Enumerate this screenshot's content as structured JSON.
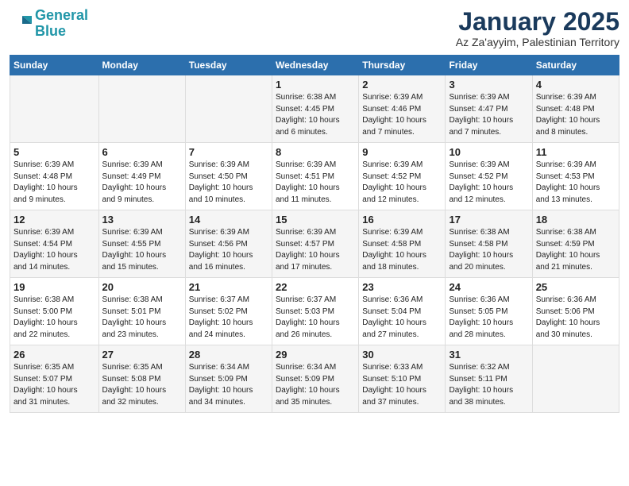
{
  "logo": {
    "line1": "General",
    "line2": "Blue"
  },
  "title": "January 2025",
  "subtitle": "Az Za'ayyim, Palestinian Territory",
  "days_of_week": [
    "Sunday",
    "Monday",
    "Tuesday",
    "Wednesday",
    "Thursday",
    "Friday",
    "Saturday"
  ],
  "weeks": [
    [
      {
        "num": "",
        "info": ""
      },
      {
        "num": "",
        "info": ""
      },
      {
        "num": "",
        "info": ""
      },
      {
        "num": "1",
        "info": "Sunrise: 6:38 AM\nSunset: 4:45 PM\nDaylight: 10 hours\nand 6 minutes."
      },
      {
        "num": "2",
        "info": "Sunrise: 6:39 AM\nSunset: 4:46 PM\nDaylight: 10 hours\nand 7 minutes."
      },
      {
        "num": "3",
        "info": "Sunrise: 6:39 AM\nSunset: 4:47 PM\nDaylight: 10 hours\nand 7 minutes."
      },
      {
        "num": "4",
        "info": "Sunrise: 6:39 AM\nSunset: 4:48 PM\nDaylight: 10 hours\nand 8 minutes."
      }
    ],
    [
      {
        "num": "5",
        "info": "Sunrise: 6:39 AM\nSunset: 4:48 PM\nDaylight: 10 hours\nand 9 minutes."
      },
      {
        "num": "6",
        "info": "Sunrise: 6:39 AM\nSunset: 4:49 PM\nDaylight: 10 hours\nand 9 minutes."
      },
      {
        "num": "7",
        "info": "Sunrise: 6:39 AM\nSunset: 4:50 PM\nDaylight: 10 hours\nand 10 minutes."
      },
      {
        "num": "8",
        "info": "Sunrise: 6:39 AM\nSunset: 4:51 PM\nDaylight: 10 hours\nand 11 minutes."
      },
      {
        "num": "9",
        "info": "Sunrise: 6:39 AM\nSunset: 4:52 PM\nDaylight: 10 hours\nand 12 minutes."
      },
      {
        "num": "10",
        "info": "Sunrise: 6:39 AM\nSunset: 4:52 PM\nDaylight: 10 hours\nand 12 minutes."
      },
      {
        "num": "11",
        "info": "Sunrise: 6:39 AM\nSunset: 4:53 PM\nDaylight: 10 hours\nand 13 minutes."
      }
    ],
    [
      {
        "num": "12",
        "info": "Sunrise: 6:39 AM\nSunset: 4:54 PM\nDaylight: 10 hours\nand 14 minutes."
      },
      {
        "num": "13",
        "info": "Sunrise: 6:39 AM\nSunset: 4:55 PM\nDaylight: 10 hours\nand 15 minutes."
      },
      {
        "num": "14",
        "info": "Sunrise: 6:39 AM\nSunset: 4:56 PM\nDaylight: 10 hours\nand 16 minutes."
      },
      {
        "num": "15",
        "info": "Sunrise: 6:39 AM\nSunset: 4:57 PM\nDaylight: 10 hours\nand 17 minutes."
      },
      {
        "num": "16",
        "info": "Sunrise: 6:39 AM\nSunset: 4:58 PM\nDaylight: 10 hours\nand 18 minutes."
      },
      {
        "num": "17",
        "info": "Sunrise: 6:38 AM\nSunset: 4:58 PM\nDaylight: 10 hours\nand 20 minutes."
      },
      {
        "num": "18",
        "info": "Sunrise: 6:38 AM\nSunset: 4:59 PM\nDaylight: 10 hours\nand 21 minutes."
      }
    ],
    [
      {
        "num": "19",
        "info": "Sunrise: 6:38 AM\nSunset: 5:00 PM\nDaylight: 10 hours\nand 22 minutes."
      },
      {
        "num": "20",
        "info": "Sunrise: 6:38 AM\nSunset: 5:01 PM\nDaylight: 10 hours\nand 23 minutes."
      },
      {
        "num": "21",
        "info": "Sunrise: 6:37 AM\nSunset: 5:02 PM\nDaylight: 10 hours\nand 24 minutes."
      },
      {
        "num": "22",
        "info": "Sunrise: 6:37 AM\nSunset: 5:03 PM\nDaylight: 10 hours\nand 26 minutes."
      },
      {
        "num": "23",
        "info": "Sunrise: 6:36 AM\nSunset: 5:04 PM\nDaylight: 10 hours\nand 27 minutes."
      },
      {
        "num": "24",
        "info": "Sunrise: 6:36 AM\nSunset: 5:05 PM\nDaylight: 10 hours\nand 28 minutes."
      },
      {
        "num": "25",
        "info": "Sunrise: 6:36 AM\nSunset: 5:06 PM\nDaylight: 10 hours\nand 30 minutes."
      }
    ],
    [
      {
        "num": "26",
        "info": "Sunrise: 6:35 AM\nSunset: 5:07 PM\nDaylight: 10 hours\nand 31 minutes."
      },
      {
        "num": "27",
        "info": "Sunrise: 6:35 AM\nSunset: 5:08 PM\nDaylight: 10 hours\nand 32 minutes."
      },
      {
        "num": "28",
        "info": "Sunrise: 6:34 AM\nSunset: 5:09 PM\nDaylight: 10 hours\nand 34 minutes."
      },
      {
        "num": "29",
        "info": "Sunrise: 6:34 AM\nSunset: 5:09 PM\nDaylight: 10 hours\nand 35 minutes."
      },
      {
        "num": "30",
        "info": "Sunrise: 6:33 AM\nSunset: 5:10 PM\nDaylight: 10 hours\nand 37 minutes."
      },
      {
        "num": "31",
        "info": "Sunrise: 6:32 AM\nSunset: 5:11 PM\nDaylight: 10 hours\nand 38 minutes."
      },
      {
        "num": "",
        "info": ""
      }
    ]
  ]
}
